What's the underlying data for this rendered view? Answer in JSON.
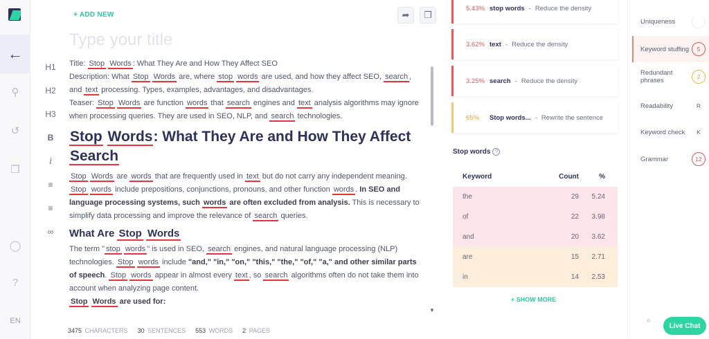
{
  "rail": {
    "language": "EN"
  },
  "toolbar": {
    "add_new": "+ ADD NEW",
    "title_placeholder": "Type your title",
    "format": [
      "H1",
      "H2",
      "H3",
      "B",
      "i"
    ]
  },
  "document": {
    "line_title": "Title:",
    "title_value": ": What They Are and How They Affect SEO",
    "heading1_rest": ": What They Are and How They Affect",
    "heading1_last": "Search",
    "heading2_prefix": "What Are",
    "k_stop": "Stop",
    "k_stop_lc": "stop",
    "k_words": "Words",
    "k_words_lc": "words",
    "k_search": "search",
    "k_text": "text"
  },
  "stats": {
    "characters": "3475",
    "characters_label": "CHARACTERS",
    "sentences": "30",
    "sentences_label": "SENTENCES",
    "words": "553",
    "words_label": "WORDS",
    "pages": "2",
    "pages_label": "PAGES"
  },
  "suggestions": [
    {
      "pct": "5.43%",
      "keyword": "stop words",
      "action": "Reduce the density"
    },
    {
      "pct": "3.62%",
      "keyword": "text",
      "action": "Reduce the density"
    },
    {
      "pct": "3.25%",
      "keyword": "search",
      "action": "Reduce the density"
    },
    {
      "pct": "65%",
      "keyword": "Stop words...",
      "action": "Rewrite the sentence"
    }
  ],
  "stop_words": {
    "title": "Stop words",
    "headers": [
      "Keyword",
      "Count",
      "%"
    ],
    "rows": [
      {
        "keyword": "the",
        "count": "29",
        "pct": "5.24",
        "bg": "#fde6ea"
      },
      {
        "keyword": "of",
        "count": "22",
        "pct": "3.98",
        "bg": "#fde6ea"
      },
      {
        "keyword": "and",
        "count": "20",
        "pct": "3.62",
        "bg": "#fde6ea"
      },
      {
        "keyword": "are",
        "count": "15",
        "pct": "2.71",
        "bg": "#fdeedc"
      },
      {
        "keyword": "in",
        "count": "14",
        "pct": "2.53",
        "bg": "#fdeedc"
      }
    ],
    "show_more": "+ SHOW MORE"
  },
  "checks": [
    {
      "label": "Uniqueness",
      "value": ""
    },
    {
      "label": "Keyword stuffing",
      "value": "5"
    },
    {
      "label": "Redundant phrases",
      "value": "2"
    },
    {
      "label": "Readability",
      "value": "R"
    },
    {
      "label": "Keyword check",
      "value": "K"
    },
    {
      "label": "Grammar",
      "value": "12"
    }
  ],
  "live_chat": "Live Chat",
  "colors": {
    "accent": "#2fd4a3",
    "danger": "#e65a5a",
    "warning": "#f0c77b",
    "navy": "#2e3159"
  }
}
